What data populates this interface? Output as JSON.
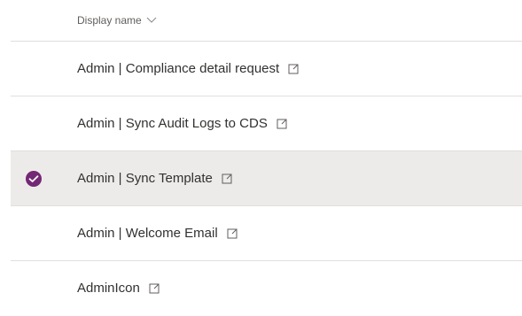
{
  "header": {
    "display_name_label": "Display name"
  },
  "rows": [
    {
      "name": "Admin | Compliance detail request",
      "selected": false
    },
    {
      "name": "Admin | Sync Audit Logs to CDS",
      "selected": false
    },
    {
      "name": "Admin | Sync Template",
      "selected": true
    },
    {
      "name": "Admin | Welcome Email",
      "selected": false
    },
    {
      "name": "AdminIcon",
      "selected": false
    }
  ],
  "colors": {
    "selected_row_bg": "#edebe9",
    "check_circle": "#742774",
    "divider": "#e1dfdd"
  },
  "icons": {
    "header_sort": "chevron-down-icon",
    "row_link": "open-in-new-icon",
    "selected_marker": "checkmark-circle-icon"
  }
}
